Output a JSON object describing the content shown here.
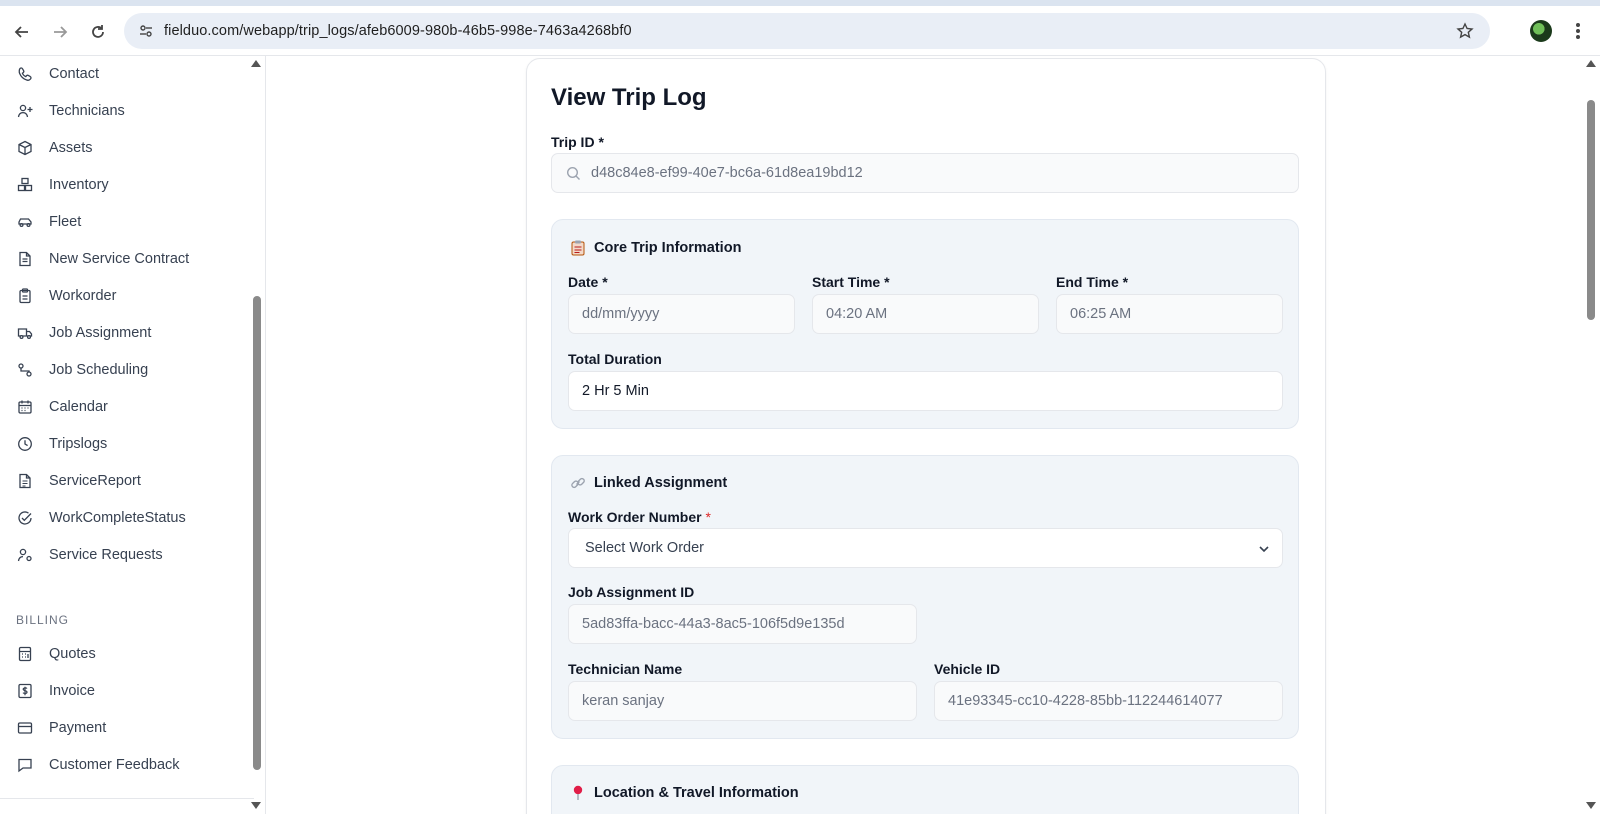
{
  "browser": {
    "url": "fielduo.com/webapp/trip_logs/afeb6009-980b-46b5-998e-7463a4268bf0"
  },
  "sidebar": {
    "items": [
      {
        "label": "Contact",
        "icon": "phone-icon"
      },
      {
        "label": "Technicians",
        "icon": "user-plus-icon"
      },
      {
        "label": "Assets",
        "icon": "box-icon"
      },
      {
        "label": "Inventory",
        "icon": "boxes-icon"
      },
      {
        "label": "Fleet",
        "icon": "car-icon"
      },
      {
        "label": "New Service Contract",
        "icon": "file-text-icon"
      },
      {
        "label": "Workorder",
        "icon": "clipboard-icon"
      },
      {
        "label": "Job Assignment",
        "icon": "truck-icon"
      },
      {
        "label": "Job Scheduling",
        "icon": "route-icon"
      },
      {
        "label": "Calendar",
        "icon": "calendar-icon"
      },
      {
        "label": "Tripslogs",
        "icon": "clock-icon"
      },
      {
        "label": "ServiceReport",
        "icon": "file-icon"
      },
      {
        "label": "WorkCompleteStatus",
        "icon": "check-circle-icon"
      },
      {
        "label": "Service Requests",
        "icon": "user-cog-icon"
      }
    ],
    "billing_section": "BILLING",
    "billing_items": [
      {
        "label": "Quotes",
        "icon": "calculator-icon"
      },
      {
        "label": "Invoice",
        "icon": "dollar-icon"
      },
      {
        "label": "Payment",
        "icon": "credit-card-icon"
      },
      {
        "label": "Customer Feedback",
        "icon": "message-icon"
      }
    ]
  },
  "page": {
    "title": "View Trip Log",
    "trip_id_label": "Trip ID *",
    "trip_id_value": "d48c84e8-ef99-40e7-bc6a-61d8ea19bd12"
  },
  "core": {
    "heading": "Core Trip Information",
    "date_label": "Date *",
    "date_placeholder": "dd/mm/yyyy",
    "start_label": "Start Time *",
    "start_value": "04:20 AM",
    "end_label": "End Time *",
    "end_value": "06:25 AM",
    "duration_label": "Total Duration",
    "duration_value": "2 Hr 5 Min"
  },
  "linked": {
    "heading": "Linked Assignment",
    "wo_label": "Work Order Number",
    "wo_required": "*",
    "wo_selected": "Select Work Order",
    "ja_label": "Job Assignment ID",
    "ja_value": "5ad83ffa-bacc-44a3-8ac5-106f5d9e135d",
    "tech_label": "Technician Name",
    "tech_value": "keran sanjay",
    "vehicle_label": "Vehicle ID",
    "vehicle_value": "41e93345-cc10-4228-85bb-112244614077"
  },
  "location": {
    "heading": "Location & Travel Information"
  },
  "colors": {
    "required": "#dc2626",
    "section_bg": "#f1f5f9",
    "pin": "#e11d48"
  }
}
